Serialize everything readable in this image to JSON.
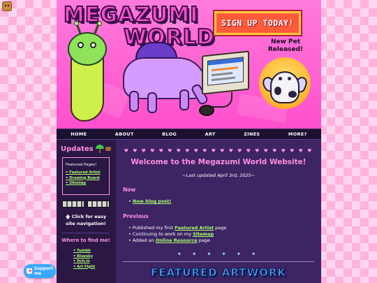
{
  "banner": {
    "title_line1": "MEGAZUMI",
    "title_line2": "WORLD",
    "signup": "SIGN UP TODAY!",
    "new_pet_line1": "New Pet",
    "new_pet_line2": "Released!"
  },
  "nav": {
    "items": [
      "HOME",
      "ABOUT",
      "BLOG",
      "ART",
      "ZINES",
      "MORE?"
    ]
  },
  "sidebar": {
    "updates_title": "Updates",
    "featured_title": "Featured Pages!",
    "featured_links": [
      "Featured Artist",
      "Drawing Board",
      "Sitemap"
    ],
    "click_nav": "🡅 Click for easy site navigation!",
    "find_title": "Where to find me!",
    "find_links": [
      "Tumblr",
      "Bluesky",
      "Itch.io",
      "Art Fight"
    ]
  },
  "main": {
    "hearts": "♥ ♥ ♥ ♥ ♥ ♥ ♥ ♥ ♥ ♥ ♥ ♥ ♥ ♥ ♥ ♥ ♥ ♥ ♥ ♥ ♥ ♥",
    "welcome": "Welcome to the Megazumi World Website!",
    "updated": "~Last updated April 3rd, 2025~",
    "now_heading": "Now",
    "now_items": [
      {
        "link": "New blog post!"
      }
    ],
    "previous_heading": "Previous",
    "previous_items": [
      {
        "pre": "Published my first ",
        "link": "Featured Artist",
        "post": " page"
      },
      {
        "pre": "Continuing to work on my ",
        "link": "Sitemap",
        "post": ""
      },
      {
        "pre": "Added an ",
        "link": "Online Resource",
        "post": " page"
      }
    ],
    "stars": "✦ ✦ ✦ ✦ ✦ ✦",
    "featured_artwork": "FEATURED ARTWORK"
  },
  "support": {
    "label": "Support me"
  },
  "colors": {
    "banner_pink": "#ff4fcd",
    "nav_bg": "#1b1030",
    "content_bg": "#3d2463",
    "accent_pink": "#ff8fe0",
    "link_green": "#a8ff6a",
    "signup_red": "#ff5a3c"
  }
}
